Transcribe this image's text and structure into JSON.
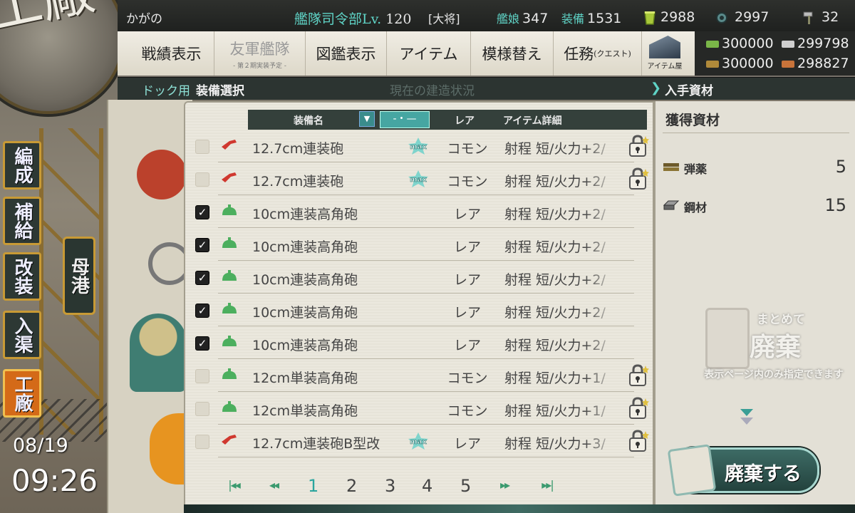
{
  "top": {
    "ship_name": "かがの",
    "admiral_label": "艦隊司令部Lv.",
    "admiral_level": "120",
    "rank": "[大将]",
    "ships_label": "艦娘",
    "ships_count": "347",
    "equip_label": "装備",
    "equip_count": "1531",
    "bucket": "2988",
    "dev_material": "2997",
    "screws": "32"
  },
  "nav": {
    "item1": "戦績表示",
    "item2": "友軍艦隊",
    "item2_sub": "- 第２期実装予定 -",
    "item3": "図鑑表示",
    "item4": "アイテム",
    "item5": "模様替え",
    "item6": "任務",
    "item6_small": "(クエスト)",
    "shop": "アイテム屋"
  },
  "resources": {
    "fuel": "300000",
    "ammo": "300000",
    "steel": "299798",
    "bauxite": "298827"
  },
  "crumbs": {
    "dock": "ドック用",
    "current": "装備選択",
    "status": "現在の建造状況",
    "gained": "入手資材"
  },
  "side": {
    "emblem": "工廠",
    "b1": "編成",
    "b2": "補給",
    "b3": "改装",
    "b4": "入渠",
    "b5": "工廠",
    "port": "母港",
    "date": "08/19",
    "time": "09:26"
  },
  "list": {
    "col_name": "装備名",
    "col_rarity": "レア",
    "col_detail": "アイテム詳細",
    "sort_icon": "▼",
    "filter_label": "-・—",
    "rows": [
      {
        "checked": false,
        "icon": "red-gun",
        "name": "12.7cm連装砲",
        "max": true,
        "rarity": "コモン",
        "detail": "射程 短/火力+2/",
        "locked": true
      },
      {
        "checked": false,
        "icon": "red-gun",
        "name": "12.7cm連装砲",
        "max": true,
        "rarity": "コモン",
        "detail": "射程 短/火力+2/",
        "locked": true
      },
      {
        "checked": true,
        "icon": "green-aa",
        "name": "10cm連装高角砲",
        "max": false,
        "rarity": "レア",
        "detail": "射程 短/火力+2/",
        "locked": false
      },
      {
        "checked": true,
        "icon": "green-aa",
        "name": "10cm連装高角砲",
        "max": false,
        "rarity": "レア",
        "detail": "射程 短/火力+2/",
        "locked": false
      },
      {
        "checked": true,
        "icon": "green-aa",
        "name": "10cm連装高角砲",
        "max": false,
        "rarity": "レア",
        "detail": "射程 短/火力+2/",
        "locked": false
      },
      {
        "checked": true,
        "icon": "green-aa",
        "name": "10cm連装高角砲",
        "max": false,
        "rarity": "レア",
        "detail": "射程 短/火力+2/",
        "locked": false
      },
      {
        "checked": true,
        "icon": "green-aa",
        "name": "10cm連装高角砲",
        "max": false,
        "rarity": "レア",
        "detail": "射程 短/火力+2/",
        "locked": false
      },
      {
        "checked": false,
        "icon": "green-aa",
        "name": "12cm単装高角砲",
        "max": false,
        "rarity": "コモン",
        "detail": "射程 短/火力+1/",
        "locked": true
      },
      {
        "checked": false,
        "icon": "green-aa",
        "name": "12cm単装高角砲",
        "max": false,
        "rarity": "コモン",
        "detail": "射程 短/火力+1/",
        "locked": true
      },
      {
        "checked": false,
        "icon": "red-gun",
        "name": "12.7cm連装砲B型改",
        "max": true,
        "rarity": "レア",
        "detail": "射程 短/火力+3/",
        "locked": true
      }
    ],
    "max_text": "max",
    "check_mark": "✓"
  },
  "pager": {
    "pages": [
      "1",
      "2",
      "3",
      "4",
      "5"
    ],
    "active": "1"
  },
  "right": {
    "title": "獲得資材",
    "mat1_label": "弾薬",
    "mat1_value": "5",
    "mat2_label": "鋼材",
    "mat2_value": "15",
    "bulk_line1": "まとめて",
    "bulk_line2": "廃棄",
    "bulk_note": "表示ページ内のみ指定できます",
    "dispose_button": "廃棄する"
  },
  "colors": {
    "accent_teal": "#5fd3c6",
    "gun_red": "#d0382f",
    "aa_green": "#4caf5e"
  }
}
